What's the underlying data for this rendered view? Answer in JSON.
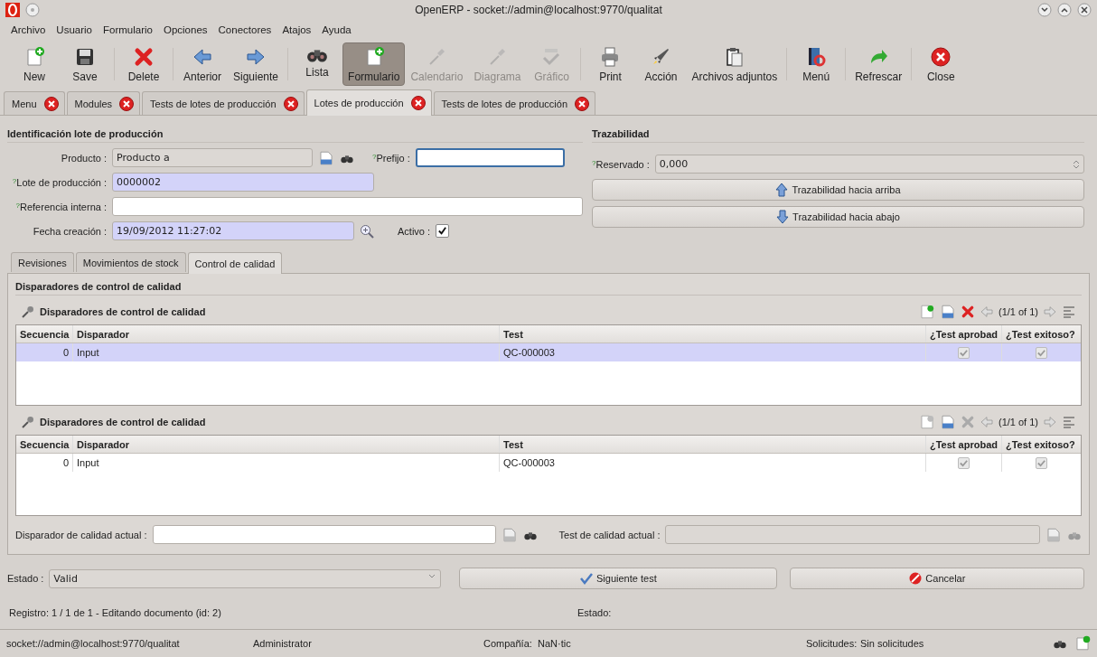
{
  "window": {
    "title": "OpenERP - socket://admin@localhost:9770/qualitat"
  },
  "menu": [
    "Archivo",
    "Usuario",
    "Formulario",
    "Opciones",
    "Conectores",
    "Atajos",
    "Ayuda"
  ],
  "toolbar": [
    [
      {
        "kind": "new",
        "label": "New",
        "disabled": false,
        "selected": false
      },
      {
        "kind": "save",
        "label": "Save",
        "disabled": false,
        "selected": false
      }
    ],
    [
      {
        "kind": "delete",
        "label": "Delete",
        "disabled": false,
        "selected": false
      }
    ],
    [
      {
        "kind": "previous",
        "label": "Anterior",
        "disabled": false,
        "selected": false
      },
      {
        "kind": "next",
        "label": "Siguiente",
        "disabled": false,
        "selected": false
      }
    ],
    [
      {
        "kind": "list",
        "label": "Lista",
        "disabled": false,
        "selected": false
      },
      {
        "kind": "form",
        "label": "Formulario",
        "disabled": false,
        "selected": true
      },
      {
        "kind": "calendar",
        "label": "Calendario",
        "disabled": true,
        "selected": false
      },
      {
        "kind": "diagram",
        "label": "Diagrama",
        "disabled": true,
        "selected": false
      },
      {
        "kind": "chart",
        "label": "Gráfico",
        "disabled": true,
        "selected": false
      }
    ],
    [
      {
        "kind": "print",
        "label": "Print",
        "disabled": false,
        "selected": false
      },
      {
        "kind": "action",
        "label": "Acción",
        "disabled": false,
        "selected": false
      },
      {
        "kind": "attachments",
        "label": "Archivos adjuntos",
        "disabled": false,
        "selected": false
      }
    ],
    [
      {
        "kind": "menu",
        "label": "Menú",
        "disabled": false,
        "selected": false
      }
    ],
    [
      {
        "kind": "refresh",
        "label": "Refrescar",
        "disabled": false,
        "selected": false
      }
    ],
    [
      {
        "kind": "close",
        "label": "Close",
        "disabled": false,
        "selected": false
      }
    ]
  ],
  "tabs": [
    {
      "label": "Menu",
      "selected": false
    },
    {
      "label": "Modules",
      "selected": false
    },
    {
      "label": "Tests de lotes de producción",
      "selected": false
    },
    {
      "label": "Lotes de producción",
      "selected": true
    },
    {
      "label": "Tests de lotes de producción",
      "selected": false
    }
  ],
  "identification": {
    "title": "Identificación lote de producción",
    "product": {
      "label": "Producto :",
      "value": "Producto a",
      "readonly": true
    },
    "prefix": {
      "help": "?",
      "label": "Prefijo :",
      "focused": true
    },
    "lot": {
      "help": "?",
      "label": "Lote de producción :",
      "value": "0000002",
      "required": true
    },
    "reference": {
      "help": "?",
      "label": "Referencia interna :"
    },
    "date": {
      "label": "Fecha creación :",
      "value": "19/09/2012 11:27:02",
      "required": true
    },
    "active": {
      "label": "Activo :",
      "checked": true
    }
  },
  "traceability": {
    "title": "Trazabilidad",
    "reserved": {
      "help": "?",
      "label": "Reservado :",
      "value": "0,000"
    },
    "buttons": [
      {
        "kind": "up",
        "label": "Trazabilidad hacia arriba"
      },
      {
        "kind": "down",
        "label": "Trazabilidad hacia abajo"
      }
    ]
  },
  "notebook": {
    "tabs": [
      {
        "label": "Revisiones",
        "selected": false
      },
      {
        "label": "Movimientos de stock",
        "selected": false
      },
      {
        "label": "Control de calidad",
        "selected": true
      }
    ],
    "section_title": "Disparadores de control de calidad",
    "grids": [
      {
        "title": "Disparadores de control de calidad",
        "editable": true,
        "pager": "(1/1 of 1)",
        "columns": [
          "Secuencia",
          "Disparador",
          "Test",
          "¿Test aprobad",
          "¿Test exitoso?"
        ],
        "rows": [
          {
            "cells": [
              "0",
              "Input",
              "QC-000003"
            ],
            "approved": true,
            "successful": true,
            "selected": true
          }
        ]
      },
      {
        "title": "Disparadores de control de calidad",
        "editable": false,
        "pager": "(1/1 of 1)",
        "columns": [
          "Secuencia",
          "Disparador",
          "Test",
          "¿Test aprobad",
          "¿Test exitoso?"
        ],
        "rows": [
          {
            "cells": [
              "0",
              "Input",
              "QC-000003"
            ],
            "approved": true,
            "successful": true,
            "selected": false
          }
        ]
      }
    ],
    "current_trigger": {
      "label": "Disparador de calidad actual :"
    },
    "current_test": {
      "label": "Test de calidad actual :",
      "disabled": true
    }
  },
  "state": {
    "label": "Estado :",
    "value": "Valid"
  },
  "actions": [
    {
      "kind": "next",
      "label": "Siguiente test"
    },
    {
      "kind": "cancel",
      "label": "Cancelar"
    }
  ],
  "record_line": {
    "text": "Registro: 1 / 1 de 1 - Editando documento (id: 2)",
    "state_label": "Estado:"
  },
  "status_bar": {
    "connection": "socket://admin@localhost:9770/qualitat",
    "user": "Administrator",
    "company_label": "Compañía:",
    "company": "NaN·tic",
    "requests_label": "Solicitudes:",
    "requests": "Sin solicitudes"
  }
}
